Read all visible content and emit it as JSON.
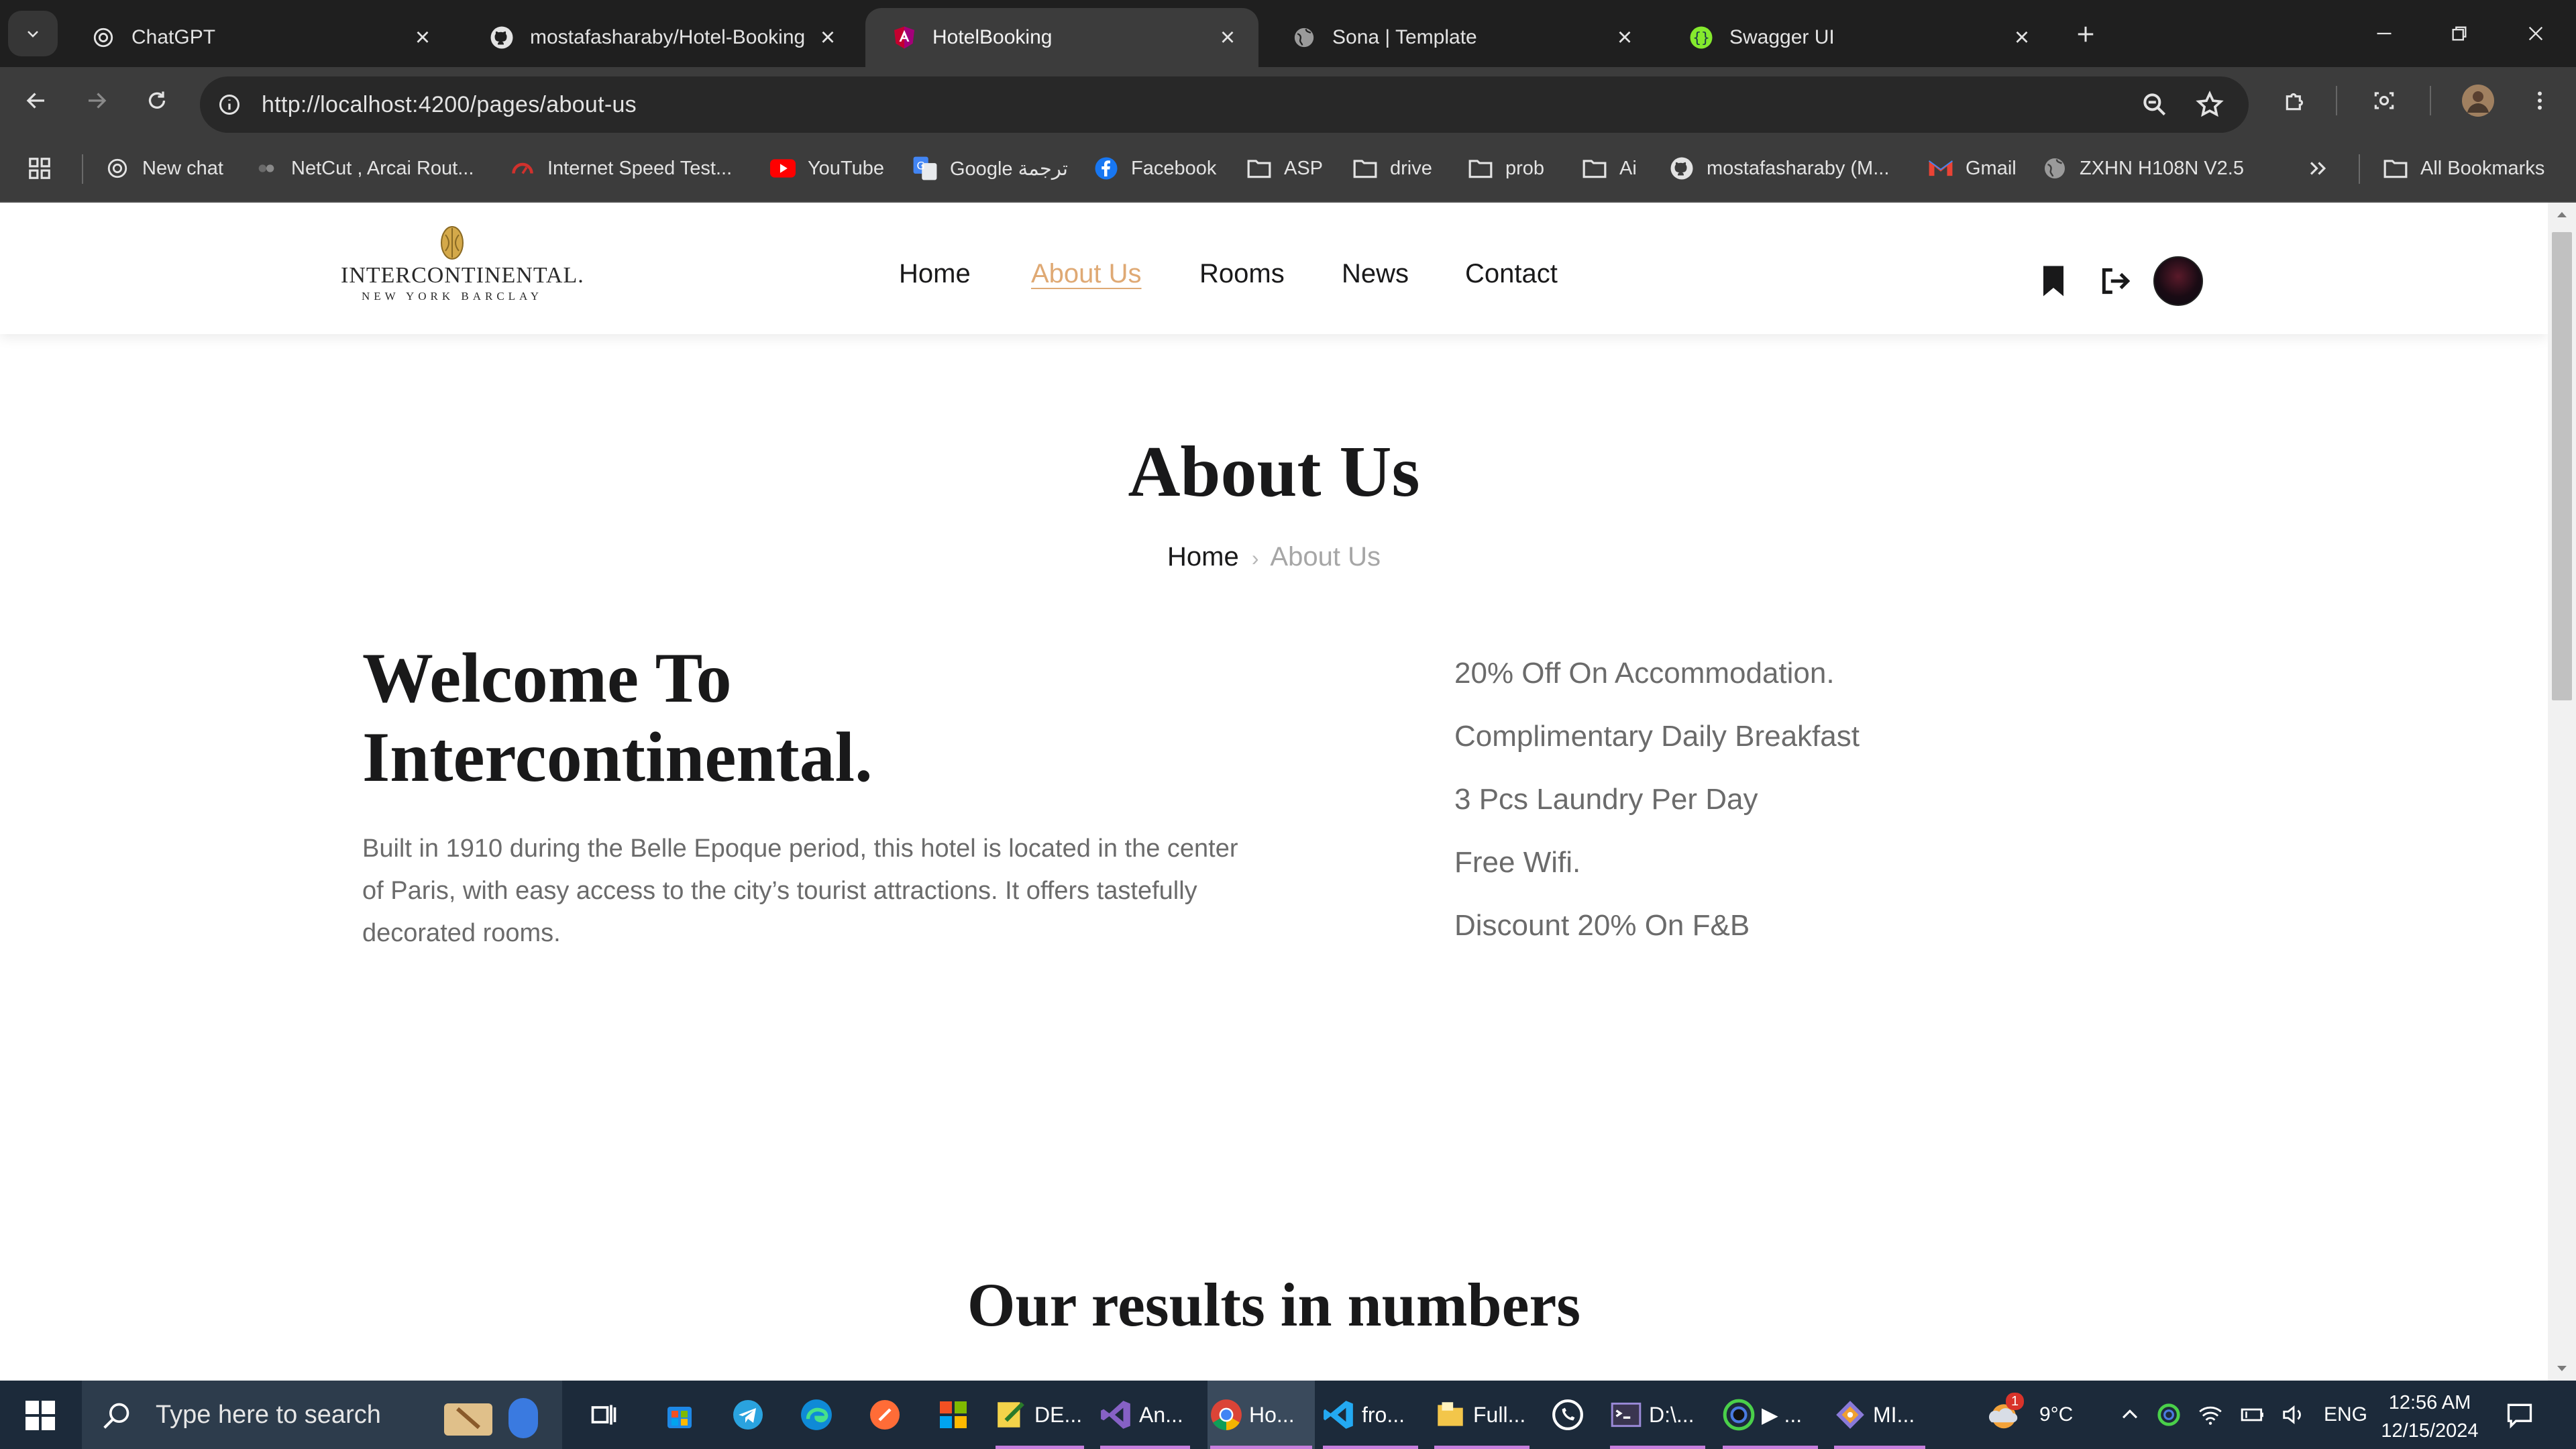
{
  "browser": {
    "tabs": [
      {
        "title": "ChatGPT",
        "active": false
      },
      {
        "title": "mostafasharaby/Hotel-Booking",
        "active": false
      },
      {
        "title": "HotelBooking",
        "active": true
      },
      {
        "title": "Sona | Template",
        "active": false
      },
      {
        "title": "Swagger UI",
        "active": false
      }
    ],
    "url": "http://localhost:4200/pages/about-us",
    "bookmarks": [
      {
        "label": "New chat",
        "icon": "chatgpt-icon"
      },
      {
        "label": "NetCut , Arcai Rout...",
        "icon": "netcut-icon"
      },
      {
        "label": "Internet Speed Test...",
        "icon": "speedtest-icon"
      },
      {
        "label": "YouTube",
        "icon": "youtube-icon"
      },
      {
        "label": "Google ترجمة",
        "icon": "google-translate-icon"
      },
      {
        "label": "Facebook",
        "icon": "facebook-icon"
      },
      {
        "label": "ASP",
        "icon": "folder-icon"
      },
      {
        "label": "drive",
        "icon": "folder-icon"
      },
      {
        "label": "prob",
        "icon": "folder-icon"
      },
      {
        "label": "Ai",
        "icon": "folder-icon"
      },
      {
        "label": "mostafasharaby (M...",
        "icon": "github-icon"
      },
      {
        "label": "Gmail",
        "icon": "gmail-icon"
      },
      {
        "label": "ZXHN H108N V2.5",
        "icon": "globe-icon"
      }
    ],
    "all_bookmarks": "All Bookmarks"
  },
  "site": {
    "logo": {
      "main": "INTERCONTINENTAL.",
      "sub": "NEW YORK BARCLAY"
    },
    "nav": [
      "Home",
      "About Us",
      "Rooms",
      "News",
      "Contact"
    ],
    "active_nav": "About Us",
    "page_title": "About Us",
    "breadcrumb": {
      "home": "Home",
      "current": "About Us"
    },
    "welcome_line1": "Welcome To",
    "welcome_line2": "Intercontinental.",
    "description": "Built in 1910 during the Belle Epoque period, this hotel is located in the center of Paris, with easy access to the city’s tourist attractions. It offers tastefully decorated rooms.",
    "features": [
      "20% Off On Accommodation.",
      "Complimentary Daily Breakfast",
      "3 Pcs Laundry Per Day",
      "Free Wifi.",
      "Discount 20% On F&B"
    ],
    "results_title": "Our results in numbers",
    "accent_color": "#dfa974"
  },
  "taskbar": {
    "search_placeholder": "Type here to search",
    "apps": [
      {
        "label": "DE...",
        "icon": "notepad-icon"
      },
      {
        "label": "An...",
        "icon": "visual-studio-icon"
      },
      {
        "label": "Ho...",
        "icon": "chrome-icon"
      },
      {
        "label": "fro...",
        "icon": "vscode-icon"
      },
      {
        "label": "Full...",
        "icon": "file-explorer-icon"
      },
      {
        "label": "D:\\...",
        "icon": "terminal-icon"
      },
      {
        "label": "▶ ...",
        "icon": "media-icon"
      },
      {
        "label": "MI...",
        "icon": "git-icon"
      }
    ],
    "weather": "9°C",
    "weather_badge": "1",
    "language": "ENG",
    "time": "12:56 AM",
    "date": "12/15/2024"
  }
}
